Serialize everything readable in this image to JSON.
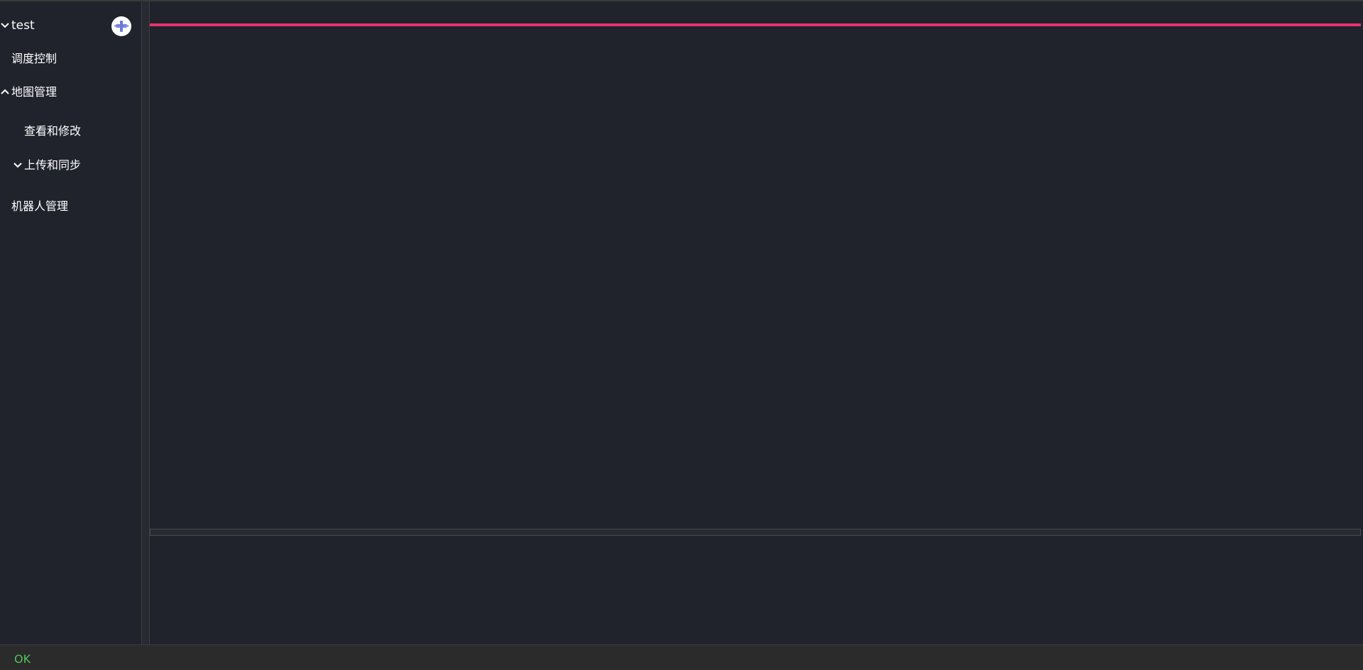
{
  "sidebar": {
    "project": {
      "label": "test",
      "expanded": true
    },
    "items": [
      {
        "label": "调度控制"
      },
      {
        "label": "地图管理",
        "expanded": true
      },
      {
        "label": "查看和修改"
      },
      {
        "label": "上传和同步",
        "expanded": false
      },
      {
        "label": "机器人管理"
      }
    ],
    "add_button_icon": "add-robot-icon"
  },
  "main": {
    "accent_color": "#e8336f"
  },
  "status_bar": {
    "text": "OK",
    "color": "#4fc35c"
  }
}
